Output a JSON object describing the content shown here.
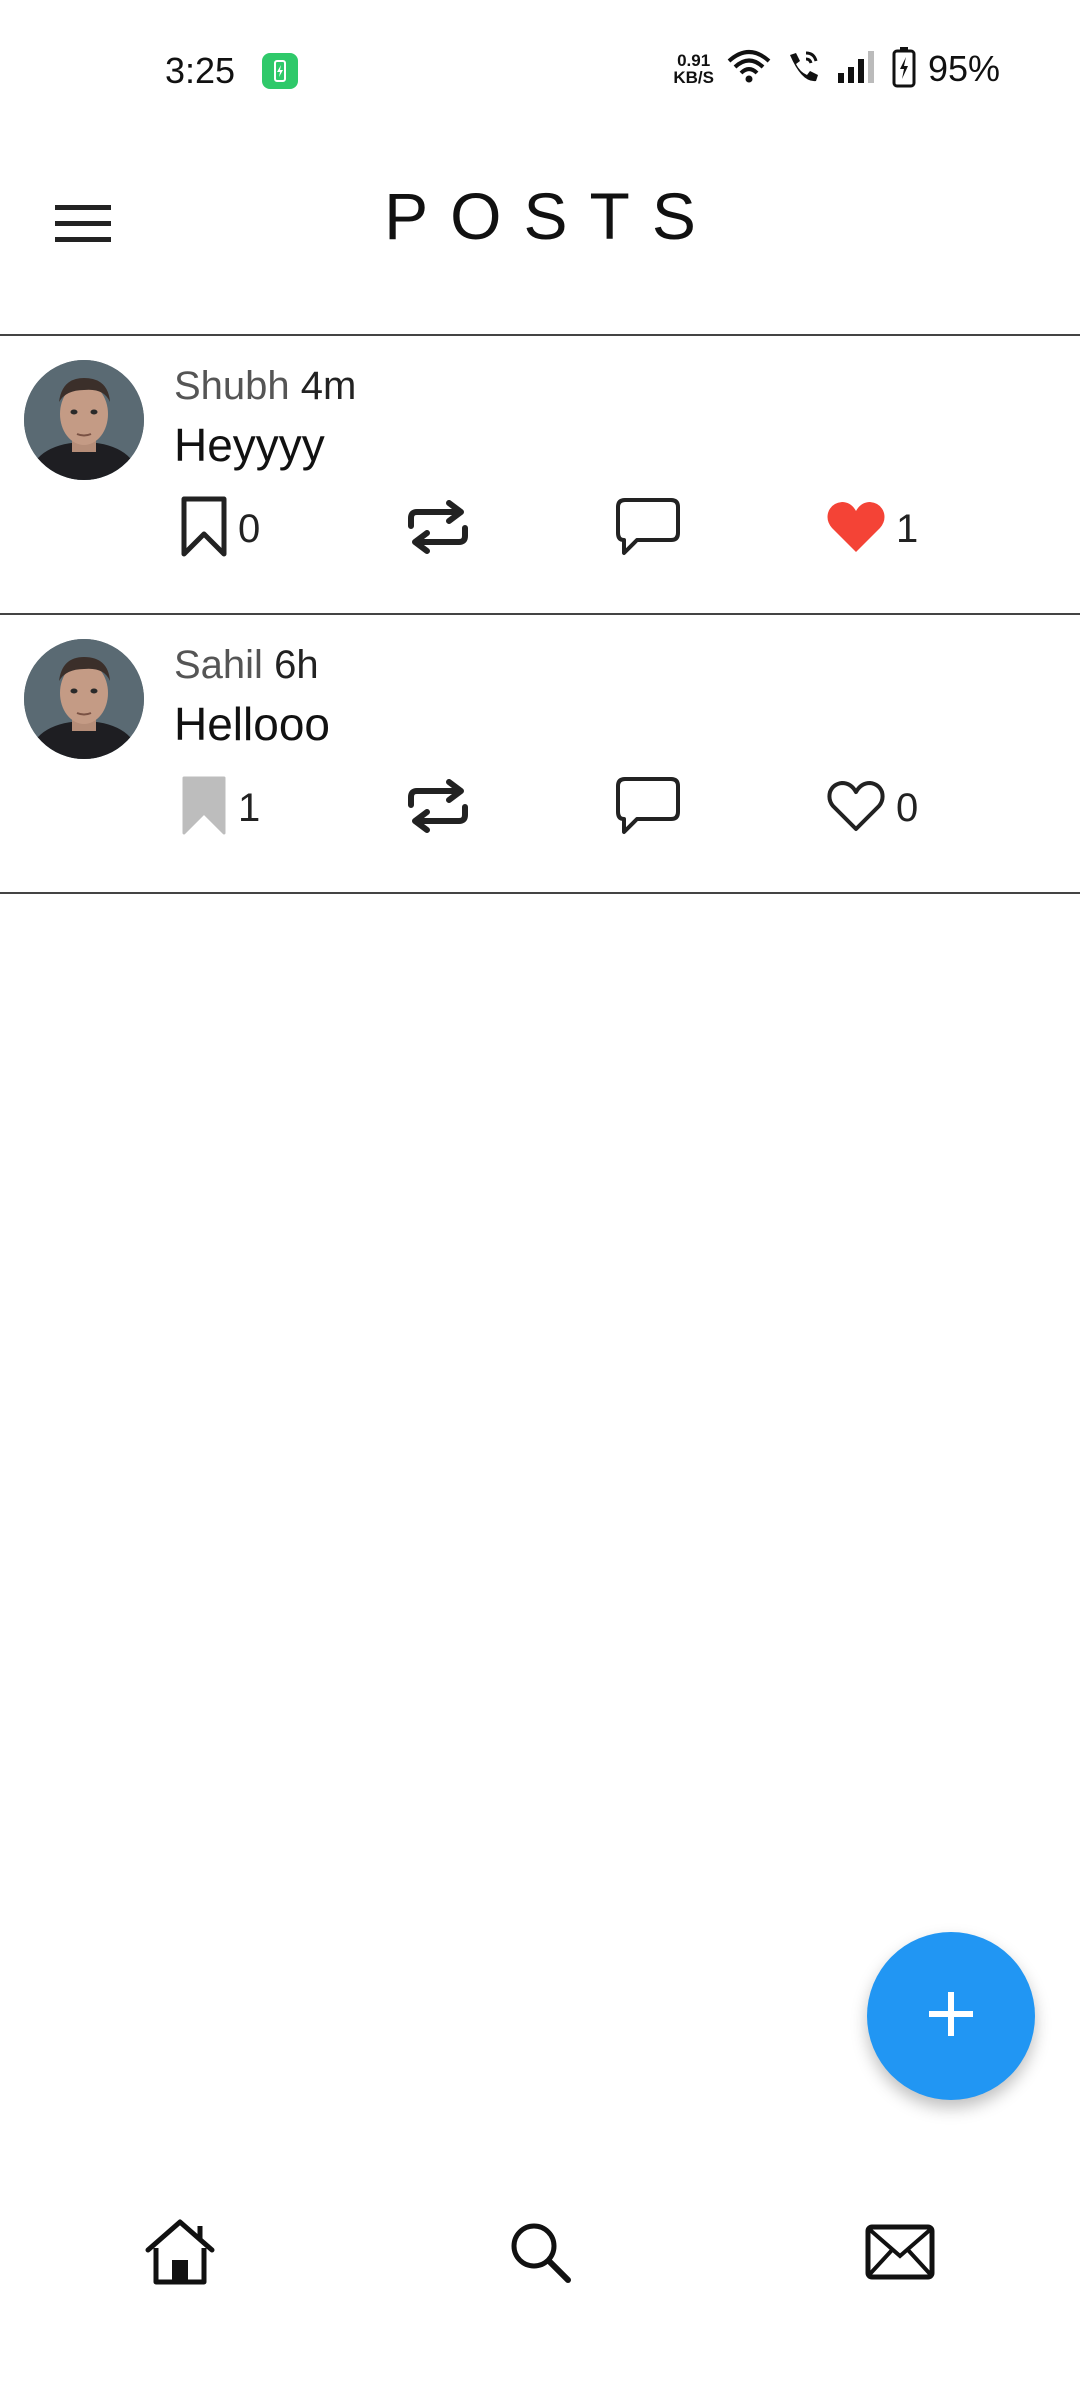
{
  "status_bar": {
    "time": "3:25",
    "net_speed_value": "0.91",
    "net_speed_unit": "KB/S",
    "battery": "95%"
  },
  "header": {
    "title": "POSTS"
  },
  "posts": [
    {
      "author": "Shubh",
      "time": "4m",
      "text": "Heyyyy",
      "bookmark_count": "0",
      "bookmarked": false,
      "like_count": "1",
      "liked": true
    },
    {
      "author": "Sahil",
      "time": "6h",
      "text": "Hellooo",
      "bookmark_count": "1",
      "bookmarked": true,
      "like_count": "0",
      "liked": false
    }
  ],
  "colors": {
    "accent": "#2196f3",
    "like": "#f44336",
    "bookmarked": "#bdbdbd",
    "divider": "#444444"
  },
  "icons": {
    "menu": "menu-icon",
    "bookmark": "bookmark-icon",
    "repost": "repost-icon",
    "comment": "comment-icon",
    "like": "heart-icon",
    "fab": "plus-icon",
    "nav_home": "home-icon",
    "nav_search": "search-icon",
    "nav_messages": "mail-icon"
  }
}
